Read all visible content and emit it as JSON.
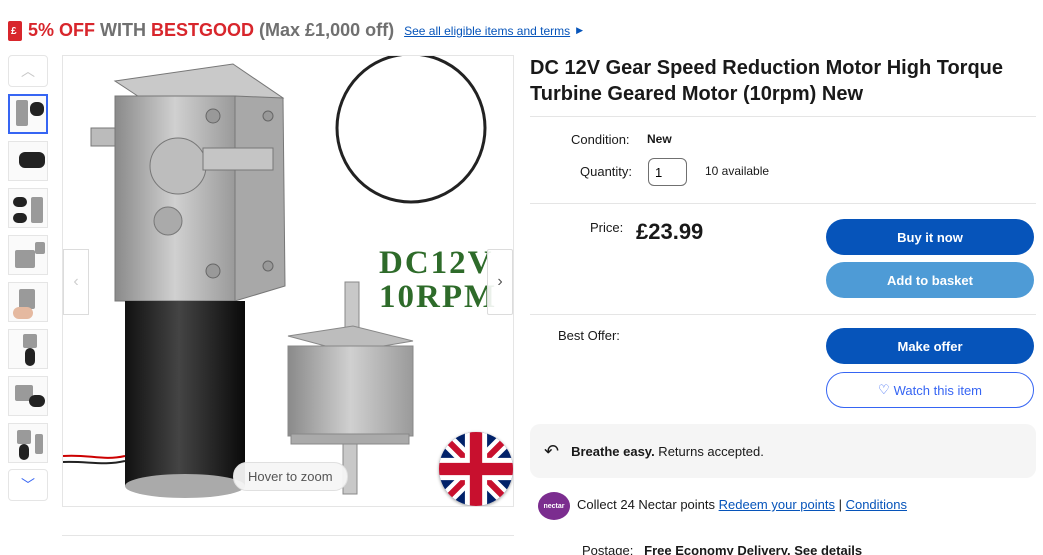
{
  "promo": {
    "pct": "5% OFF",
    "with": " WITH ",
    "code": "BESTGOOD",
    "max": " (Max £1,000 off)",
    "link": "See all eligible items and terms"
  },
  "gallery": {
    "hover_zoom": "Hover to zoom",
    "overlay_line1": "DC12V",
    "overlay_line2": "10RPM"
  },
  "listing": {
    "title": "DC 12V Gear Speed Reduction Motor High Torque Turbine Geared Motor (10rpm) New",
    "condition_label": "Condition:",
    "condition_value": "New",
    "quantity_label": "Quantity:",
    "quantity_value": "1",
    "available": "10 available",
    "price_label": "Price:",
    "price": "£23.99",
    "best_offer_label": "Best Offer:"
  },
  "actions": {
    "buy_now": "Buy it now",
    "add_to_basket": "Add to basket",
    "make_offer": "Make offer",
    "watch": "Watch this item"
  },
  "returns": {
    "bold": "Breathe easy.",
    "rest": " Returns accepted."
  },
  "nectar": {
    "logo": "nectar",
    "text": "Collect 24 Nectar points ",
    "redeem": "Redeem your points",
    "sep": " | ",
    "conditions": "Conditions"
  },
  "postage": {
    "label": "Postage:",
    "value": "Free Economy Delivery. See details"
  },
  "colors": {
    "accent": "#0654ba",
    "promo_red": "#d8262c",
    "secondary_button": "#4e9bd6"
  }
}
